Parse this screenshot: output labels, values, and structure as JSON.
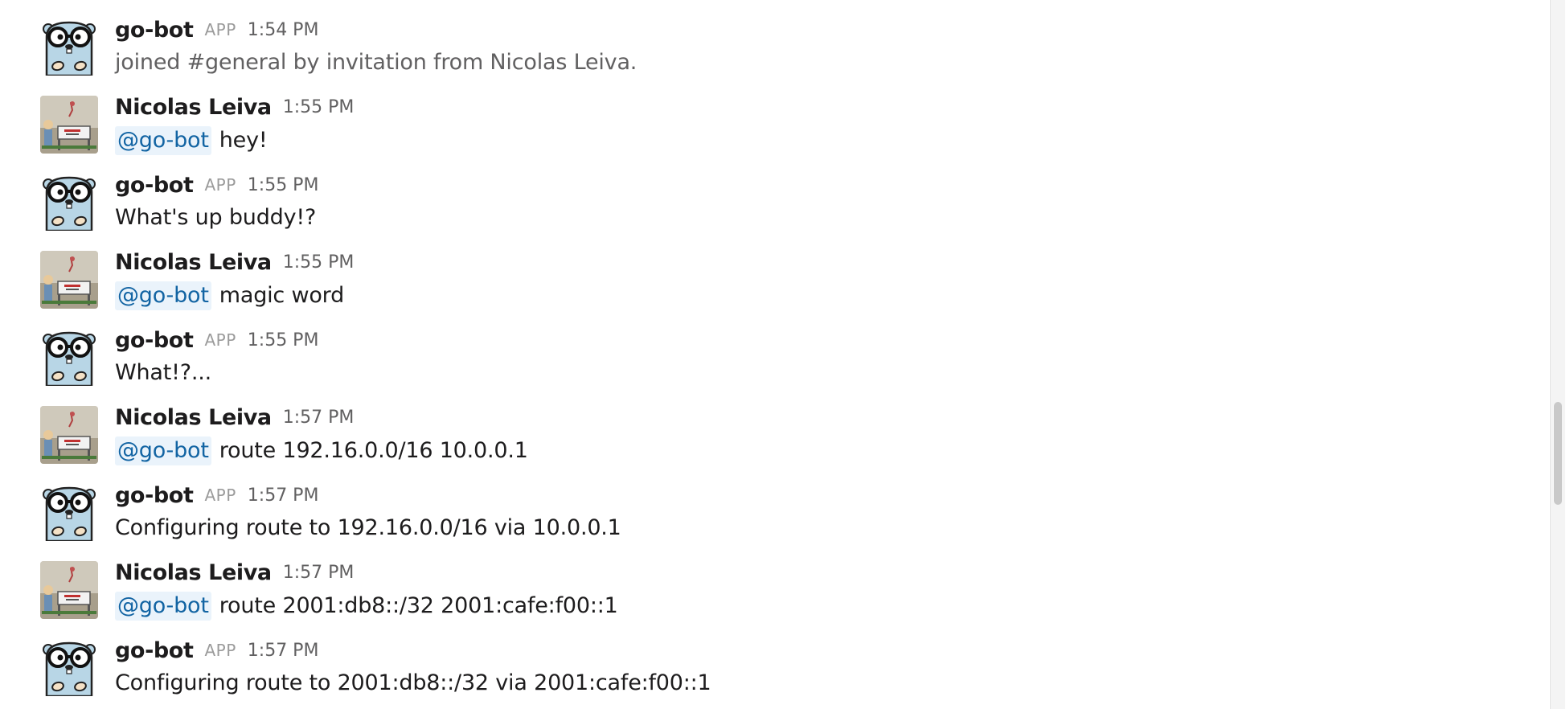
{
  "messages": [
    {
      "sender": "go-bot",
      "app_badge": "APP",
      "time": "1:54 PM",
      "mention": "",
      "text": "joined #general by invitation from Nicolas Leiva.",
      "avatar_icon": "gopher-glasses-icon"
    },
    {
      "sender": "Nicolas Leiva",
      "app_badge": "",
      "time": "1:55 PM",
      "mention": "@go-bot",
      "text": "hey!",
      "avatar_icon": "office-illustration-icon"
    },
    {
      "sender": "go-bot",
      "app_badge": "APP",
      "time": "1:55 PM",
      "mention": "",
      "text": "What's up buddy!?",
      "avatar_icon": "gopher-glasses-icon"
    },
    {
      "sender": "Nicolas Leiva",
      "app_badge": "",
      "time": "1:55 PM",
      "mention": "@go-bot",
      "text": "magic word",
      "avatar_icon": "office-illustration-icon"
    },
    {
      "sender": "go-bot",
      "app_badge": "APP",
      "time": "1:55 PM",
      "mention": "",
      "text": "What!?...",
      "avatar_icon": "gopher-glasses-icon"
    },
    {
      "sender": "Nicolas Leiva",
      "app_badge": "",
      "time": "1:57 PM",
      "mention": "@go-bot",
      "text": "route 192.16.0.0/16 10.0.0.1",
      "avatar_icon": "office-illustration-icon"
    },
    {
      "sender": "go-bot",
      "app_badge": "APP",
      "time": "1:57 PM",
      "mention": "",
      "text": "Configuring route to 192.16.0.0/16 via 10.0.0.1",
      "avatar_icon": "gopher-glasses-icon"
    },
    {
      "sender": "Nicolas Leiva",
      "app_badge": "",
      "time": "1:57 PM",
      "mention": "@go-bot",
      "text": "route 2001:db8::/32 2001:cafe:f00::1",
      "avatar_icon": "office-illustration-icon"
    },
    {
      "sender": "go-bot",
      "app_badge": "APP",
      "time": "1:57 PM",
      "mention": "",
      "text": "Configuring route to 2001:db8::/32 via 2001:cafe:f00::1",
      "avatar_icon": "gopher-glasses-icon"
    }
  ],
  "colors": {
    "mention_text": "#1264a3",
    "mention_bg": "#eaf3fb",
    "timestamp": "#616061",
    "app_badge": "#9b9b9b",
    "gopher_body": "#b8d6e6"
  }
}
